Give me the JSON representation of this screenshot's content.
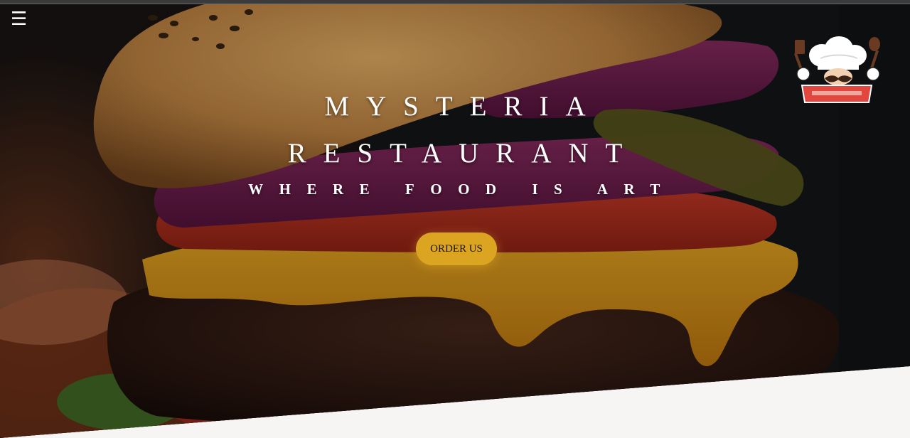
{
  "nav": {
    "menu_icon": "hamburger-menu-icon",
    "menu_glyph": "☰"
  },
  "logo": {
    "icon": "chef-logo-icon"
  },
  "hero": {
    "title_line1": "MYSTERIA",
    "title_line2": "RESTAURANT",
    "tagline": "WHERE FOOD IS ART",
    "cta_label": "ORDER US",
    "background_image": "burger-photo"
  },
  "colors": {
    "accent": "#dba521",
    "title_text": "#ffffff",
    "page_background": "#f6f5f3",
    "logo_banner": "#e2473f"
  }
}
